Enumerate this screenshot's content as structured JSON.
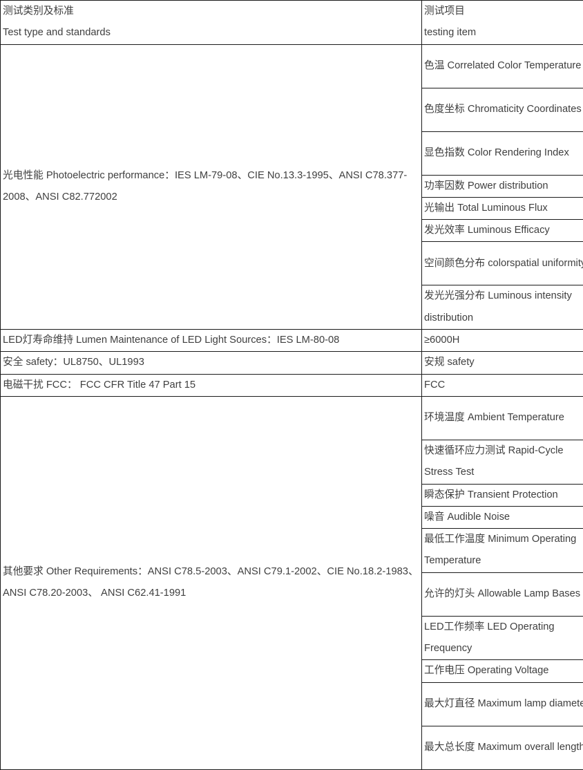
{
  "table": {
    "headers": {
      "left_cn": "测试类别及标准",
      "left_en": "Test type and standards",
      "right_cn": "测试项目",
      "right_en": "testing item"
    },
    "groups": [
      {
        "category": "光电性能 Photoelectric performance：IES LM-79-08、CIE No.13.3-1995、ANSI C78.377-2008、ANSI C82.772002",
        "items": [
          "色温 Correlated Color Temperature",
          "色度坐标 Chromaticity Coordinates",
          "显色指数 Color Rendering Index",
          "功率因数 Power distribution",
          "光输出 Total Luminous Flux",
          "发光效率 Luminous Efficacy",
          "空间颜色分布 colorspatial uniformity",
          "发光光强分布 Luminous intensity distribution"
        ]
      },
      {
        "category": "LED灯寿命维持 Lumen Maintenance of LED Light Sources：IES LM-80-08",
        "items": [
          "≥6000H"
        ]
      },
      {
        "category": "安全 safety：UL8750、UL1993",
        "items": [
          "安规 safety"
        ]
      },
      {
        "category": "电磁干扰 FCC： FCC CFR Title 47 Part 15",
        "items": [
          "FCC"
        ]
      },
      {
        "category": "其他要求 Other Requirements：ANSI C78.5-2003、ANSI C79.1-2002、CIE No.18.2-1983、ANSI C78.20-2003、 ANSI C62.41-1991",
        "items": [
          "环境温度 Ambient Temperature",
          "快速循环应力测试 Rapid-Cycle Stress Test",
          "瞬态保护 Transient Protection",
          "噪音 Audible Noise",
          "最低工作温度 Minimum Operating Temperature",
          "允许的灯头 Allowable Lamp Bases",
          "LED工作频率 LED Operating Frequency",
          "工作电压 Operating Voltage",
          "最大灯直径 Maximum lamp diameter",
          "最大总长度 Maximum overall length"
        ]
      }
    ],
    "row_heights": {
      "header": 2,
      "item_lines": [
        2,
        2,
        2,
        1,
        1,
        1,
        2,
        2,
        1,
        1,
        1,
        2,
        2,
        1,
        1,
        2,
        2,
        2,
        1,
        2,
        2
      ]
    },
    "colors": {
      "border": "#1a1a1a",
      "text": "#3f3f3f",
      "background": "#ffffff"
    }
  }
}
